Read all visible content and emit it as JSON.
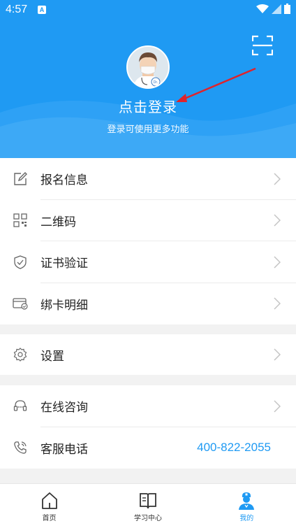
{
  "status_bar": {
    "time": "4:57",
    "badge": "A"
  },
  "header": {
    "login_title": "点击登录",
    "login_subtitle": "登录可使用更多功能"
  },
  "menu": {
    "group1": [
      {
        "label": "报名信息",
        "icon": "edit-icon"
      },
      {
        "label": "二维码",
        "icon": "qrcode-icon"
      },
      {
        "label": "证书验证",
        "icon": "shield-check-icon"
      },
      {
        "label": "绑卡明细",
        "icon": "card-icon"
      }
    ],
    "group2": [
      {
        "label": "设置",
        "icon": "gear-icon"
      }
    ],
    "group3": [
      {
        "label": "在线咨询",
        "icon": "headset-icon"
      },
      {
        "label": "客服电话",
        "icon": "phone-icon",
        "value": "400-822-2055"
      }
    ]
  },
  "bottom_nav": {
    "tabs": [
      {
        "label": "首页",
        "icon": "home-icon"
      },
      {
        "label": "学习中心",
        "icon": "book-icon"
      },
      {
        "label": "我的",
        "icon": "doctor-icon",
        "active": true
      }
    ]
  },
  "colors": {
    "primary": "#1f9af3",
    "annotation_arrow": "#e0232b"
  }
}
